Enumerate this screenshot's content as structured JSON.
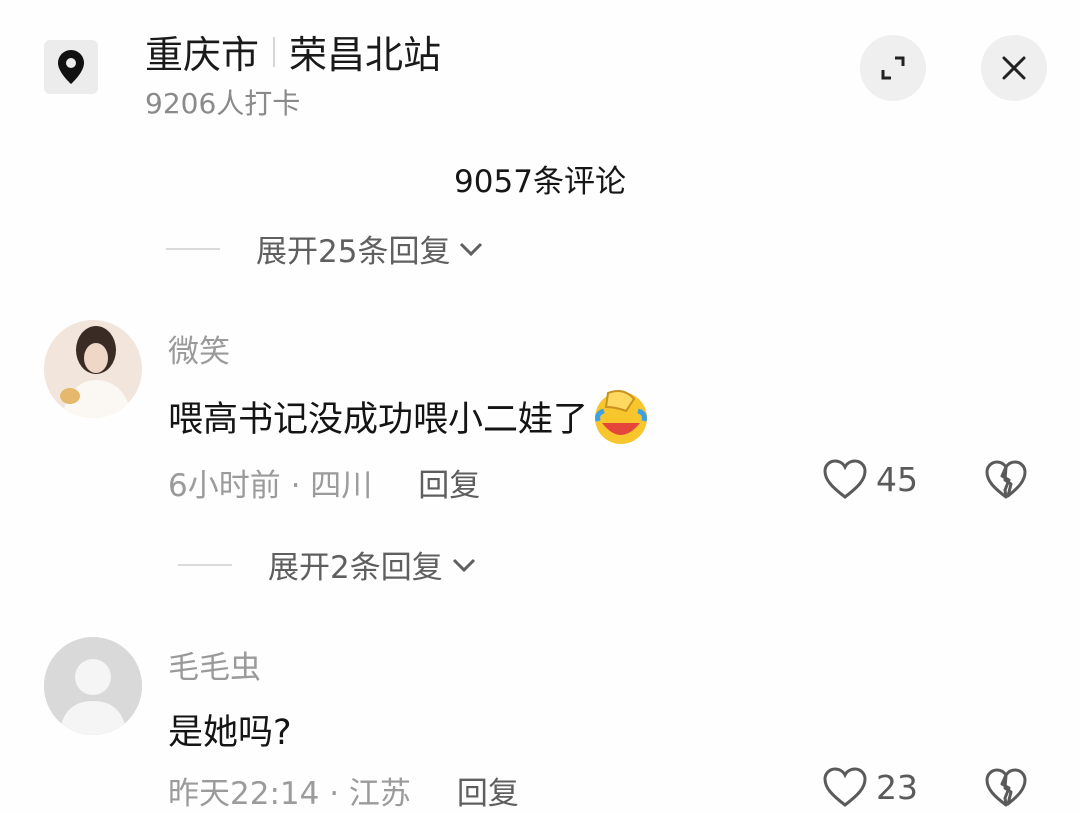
{
  "header": {
    "city": "重庆市",
    "place": "荣昌北站",
    "checkins": "9206人打卡",
    "location_icon": "location-pin-icon",
    "expand_icon": "expand-icon",
    "close_icon": "close-icon"
  },
  "comments_count": "9057条评论",
  "expand_top": "展开25条回复",
  "comments": [
    {
      "user": "微笑",
      "text": "喂高书记没成功喂小二娃了",
      "emoji_icon": "facepalm-laugh-emoji-icon",
      "time_location": "6小时前 · 四川",
      "reply_label": "回复",
      "likes": "45",
      "expand_label": "展开2条回复"
    },
    {
      "user": "毛毛虫",
      "text": "是她吗?",
      "time_location": "昨天22:14 · 江苏",
      "reply_label": "回复",
      "likes": "23"
    }
  ],
  "colors": {
    "background": "#fefefe",
    "icon_bg": "#efefef",
    "muted": "#9a9a9a"
  }
}
